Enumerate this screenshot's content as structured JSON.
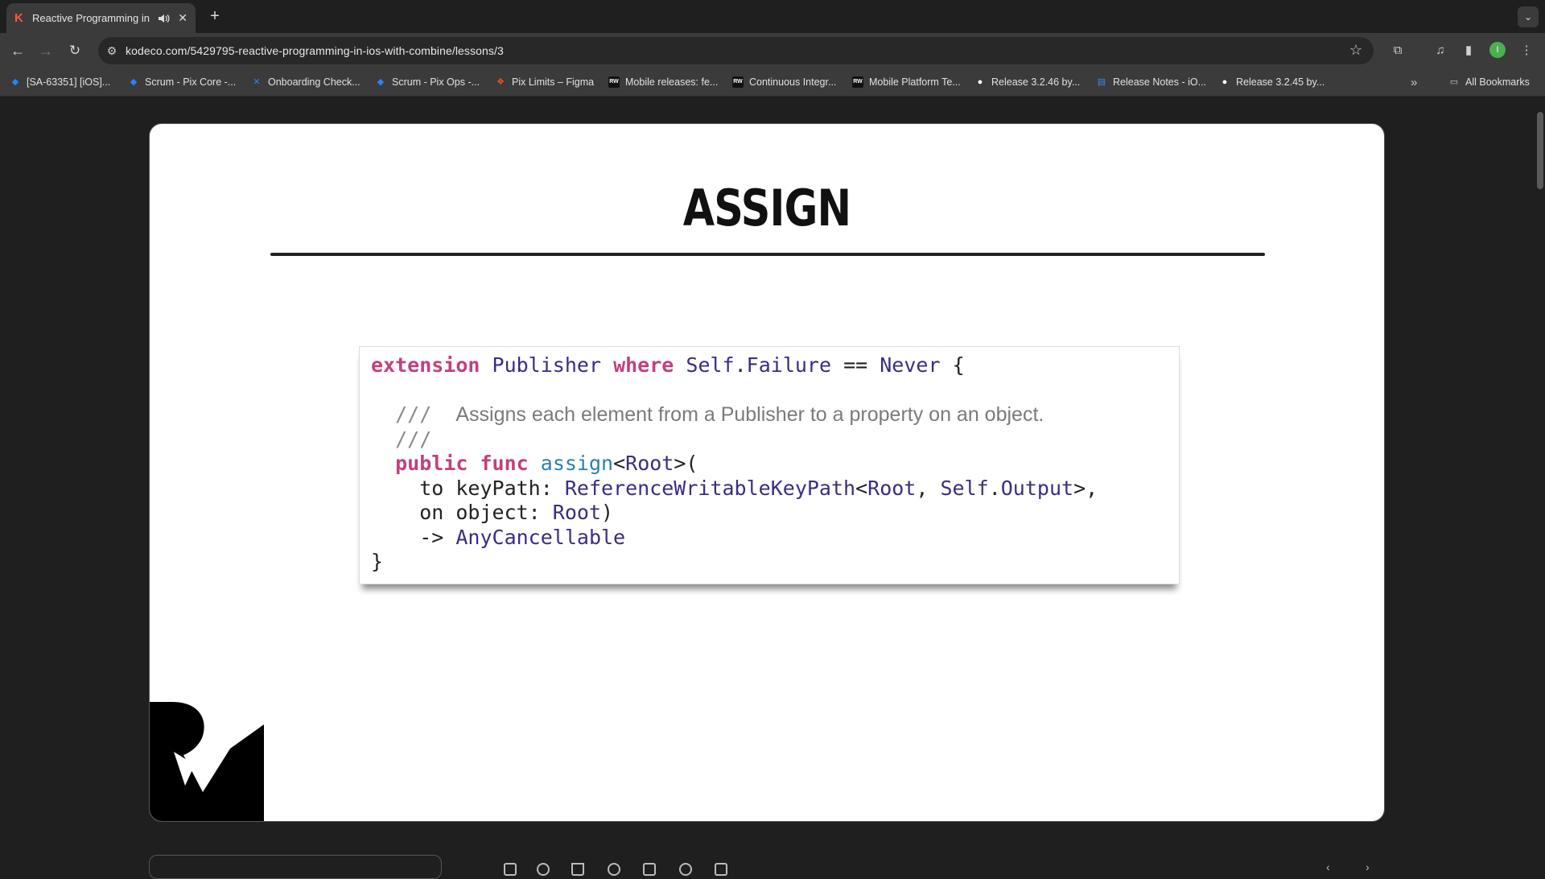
{
  "browser": {
    "tab": {
      "title": "Reactive Programming in iOS with Combine"
    },
    "url": "kodeco.com/5429795-reactive-programming-in-ios-with-combine/lessons/3",
    "bookmarks": [
      {
        "label": "[SA-63351] [iOS]...",
        "icon": "jira-icon"
      },
      {
        "label": "Scrum - Pix Core -...",
        "icon": "jira-icon"
      },
      {
        "label": "Onboarding Check...",
        "icon": "confluence-icon"
      },
      {
        "label": "Scrum - Pix Ops -...",
        "icon": "jira-icon"
      },
      {
        "label": "Pix Limits – Figma",
        "icon": "figma-icon"
      },
      {
        "label": "Mobile releases: fe...",
        "icon": "rw-icon"
      },
      {
        "label": "Continuous Integr...",
        "icon": "rw-icon"
      },
      {
        "label": "Mobile Platform Te...",
        "icon": "rw-icon"
      },
      {
        "label": "Release 3.2.46 by...",
        "icon": "github-icon"
      },
      {
        "label": "Release Notes - iO...",
        "icon": "docs-icon"
      },
      {
        "label": "Release 3.2.45 by...",
        "icon": "github-icon"
      }
    ],
    "all_bookmarks": "All Bookmarks",
    "avatar_initial": "I"
  },
  "slide": {
    "title": "ASSIGN",
    "code": {
      "l1": {
        "kw1": "extension",
        "t1": "Publisher",
        "kw2": "where",
        "t2": "Self",
        "t3": "Failure",
        "op": " == ",
        "t4": "Never",
        "end": " {"
      },
      "l2_slashes": "///",
      "l2_text": "Assigns each element from a Publisher to a property on an object.",
      "l3_slashes": "///",
      "l4": {
        "kw1": "public",
        "kw2": "func",
        "fn": "assign",
        "t1": "Root",
        "end": ">("
      },
      "l5": {
        "pre": "to keyPath: ",
        "t1": "ReferenceWritableKeyPath",
        "t2": "Root",
        "t3": "Self",
        "t4": "Output",
        "end": ">,"
      },
      "l6": {
        "pre": "on object: ",
        "t1": "Root",
        "end": ")"
      },
      "l7": {
        "pre": "-> ",
        "t1": "AnyCancellable"
      },
      "l8": "}"
    }
  },
  "colors": {
    "keyword": "#c3407c",
    "type": "#3d2b82",
    "function": "#2b7fb0",
    "comment": "#8a8a8a"
  }
}
